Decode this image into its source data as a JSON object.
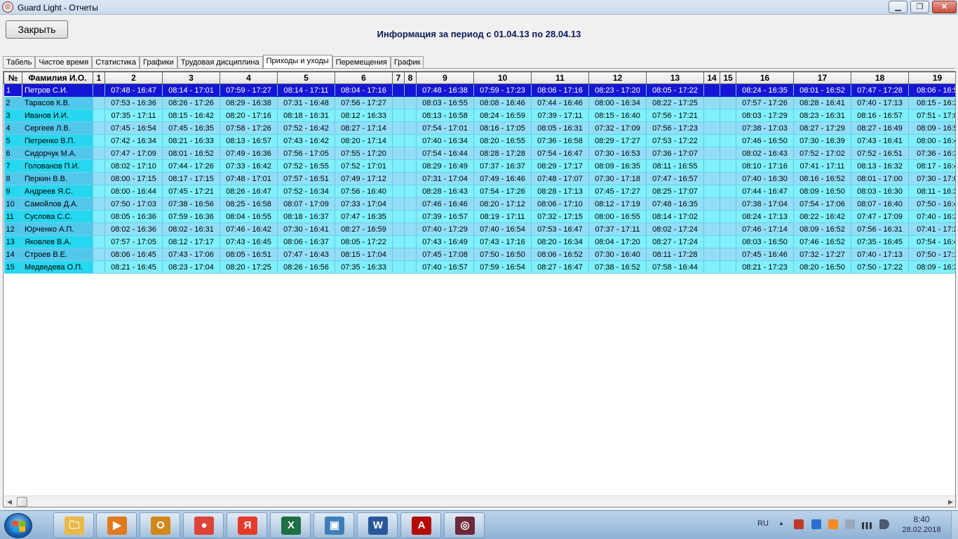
{
  "window": {
    "title": "Guard Light - Отчеты",
    "icon": "app-logo-icon",
    "controls": {
      "minimize": "▁",
      "maximize": "❐",
      "close": "✕"
    }
  },
  "toolbar": {
    "close_label": "Закрыть",
    "period_title": "Информация за период с 01.04.13 по 28.04.13"
  },
  "tabs": [
    {
      "label": "Табель",
      "active": false
    },
    {
      "label": "Чистое время",
      "active": false
    },
    {
      "label": "Статистика",
      "active": false
    },
    {
      "label": "Графики",
      "active": false
    },
    {
      "label": "Трудовая дисциплина",
      "active": false
    },
    {
      "label": "Приходы и уходы",
      "active": true
    },
    {
      "label": "Перемещения",
      "active": false
    },
    {
      "label": "График",
      "active": false
    }
  ],
  "grid": {
    "headers": [
      "№",
      "Фамилия И.О.",
      "1",
      "2",
      "3",
      "4",
      "5",
      "6",
      "7",
      "8",
      "9",
      "10",
      "11",
      "12",
      "13",
      "14",
      "15",
      "16",
      "17",
      "18",
      "19"
    ],
    "selected_row": 0,
    "rows": [
      {
        "num": "1",
        "name": "Петров С.И.",
        "days": [
          "",
          "07:48 - 16:47",
          "08:14 - 17:01",
          "07:59 - 17:27",
          "08:14 - 17:11",
          "08:04 - 17:16",
          "",
          "",
          "07:48 - 16:38",
          "07:59 - 17:23",
          "08:06 - 17:16",
          "08:23 - 17:20",
          "08:05 - 17:22",
          "",
          "",
          "08:24 - 16:35",
          "08:01 - 16:52",
          "07:47 - 17:28",
          "08:06 - 16:5"
        ]
      },
      {
        "num": "2",
        "name": "Тарасов К.В.",
        "days": [
          "",
          "07:53 - 16:36",
          "08:26 - 17:26",
          "08:29 - 16:38",
          "07:31 - 16:48",
          "07:56 - 17:27",
          "",
          "",
          "08:03 - 16:55",
          "08:08 - 16:46",
          "07:44 - 16:46",
          "08:00 - 16:34",
          "08:22 - 17:25",
          "",
          "",
          "07:57 - 17:26",
          "08:28 - 16:41",
          "07:40 - 17:13",
          "08:15 - 16:3"
        ]
      },
      {
        "num": "3",
        "name": "Иванов И.И.",
        "days": [
          "",
          "07:35 - 17:11",
          "08:15 - 16:42",
          "08:20 - 17:16",
          "08:18 - 16:31",
          "08:12 - 16:33",
          "",
          "",
          "08:13 - 16:58",
          "08:24 - 16:59",
          "07:39 - 17:11",
          "08:15 - 16:40",
          "07:56 - 17:21",
          "",
          "",
          "08:03 - 17:29",
          "08:23 - 16:31",
          "08:16 - 16:57",
          "07:51 - 17:0"
        ]
      },
      {
        "num": "4",
        "name": "Сергеев Л.В.",
        "days": [
          "",
          "07:45 - 16:54",
          "07:45 - 16:35",
          "07:58 - 17:26",
          "07:52 - 16:42",
          "08:27 - 17:14",
          "",
          "",
          "07:54 - 17:01",
          "08:16 - 17:05",
          "08:05 - 16:31",
          "07:32 - 17:09",
          "07:56 - 17:23",
          "",
          "",
          "07:38 - 17:03",
          "08:27 - 17:29",
          "08:27 - 16:49",
          "08:09 - 16:5"
        ]
      },
      {
        "num": "5",
        "name": "Петренко В.П.",
        "days": [
          "",
          "07:42 - 16:34",
          "08:21 - 16:33",
          "08:13 - 16:57",
          "07:43 - 16:42",
          "08:20 - 17:14",
          "",
          "",
          "07:40 - 16:34",
          "08:20 - 16:55",
          "07:36 - 16:58",
          "08:29 - 17:27",
          "07:53 - 17:22",
          "",
          "",
          "07:46 - 16:50",
          "07:30 - 16:39",
          "07:43 - 16:41",
          "08:00 - 16:4"
        ]
      },
      {
        "num": "6",
        "name": "Сидорчук М.А.",
        "days": [
          "",
          "07:47 - 17:09",
          "08:01 - 16:52",
          "07:49 - 16:36",
          "07:56 - 17:05",
          "07:55 - 17:20",
          "",
          "",
          "07:54 - 16:44",
          "08:28 - 17:28",
          "07:54 - 16:47",
          "07:30 - 16:53",
          "07:36 - 17:07",
          "",
          "",
          "08:02 - 16:43",
          "07:52 - 17:02",
          "07:52 - 16:51",
          "07:36 - 16:3"
        ]
      },
      {
        "num": "7",
        "name": "Голованов П.И.",
        "days": [
          "",
          "08:02 - 17:10",
          "07:44 - 17:26",
          "07:33 - 16:42",
          "07:52 - 16:55",
          "07:52 - 17:01",
          "",
          "",
          "08:29 - 16:49",
          "07:37 - 16:37",
          "08:29 - 17:17",
          "08:09 - 16:35",
          "08:11 - 16:55",
          "",
          "",
          "08:10 - 17:16",
          "07:41 - 17:11",
          "08:13 - 16:32",
          "08:17 - 16:4"
        ]
      },
      {
        "num": "8",
        "name": "Перкин В.В.",
        "days": [
          "",
          "08:00 - 17:15",
          "08:17 - 17:15",
          "07:48 - 17:01",
          "07:57 - 16:51",
          "07:49 - 17:12",
          "",
          "",
          "07:31 - 17:04",
          "07:49 - 16:46",
          "07:48 - 17:07",
          "07:30 - 17:18",
          "07:47 - 16:57",
          "",
          "",
          "07:40 - 16:30",
          "08:16 - 16:52",
          "08:01 - 17:00",
          "07:30 - 17:0"
        ]
      },
      {
        "num": "9",
        "name": "Андреев Я.С.",
        "days": [
          "",
          "08:00 - 16:44",
          "07:45 - 17:21",
          "08:26 - 16:47",
          "07:52 - 16:34",
          "07:56 - 16:40",
          "",
          "",
          "08:28 - 16:43",
          "07:54 - 17:26",
          "08:28 - 17:13",
          "07:45 - 17:27",
          "08:25 - 17:07",
          "",
          "",
          "07:44 - 16:47",
          "08:09 - 16:50",
          "08:03 - 16:30",
          "08:11 - 16:3"
        ]
      },
      {
        "num": "10",
        "name": "Самойлов Д.А.",
        "days": [
          "",
          "07:50 - 17:03",
          "07:38 - 16:56",
          "08:25 - 16:58",
          "08:07 - 17:09",
          "07:33 - 17:04",
          "",
          "",
          "07:46 - 16:46",
          "08:20 - 17:12",
          "08:06 - 17:10",
          "08:12 - 17:19",
          "07:48 - 16:35",
          "",
          "",
          "07:38 - 17:04",
          "07:54 - 17:06",
          "08:07 - 16:40",
          "07:50 - 16:4"
        ]
      },
      {
        "num": "11",
        "name": "Суслова С.С.",
        "days": [
          "",
          "08:05 - 16:36",
          "07:59 - 16:36",
          "08:04 - 16:55",
          "08:18 - 16:37",
          "07:47 - 16:35",
          "",
          "",
          "07:39 - 16:57",
          "08:19 - 17:11",
          "07:32 - 17:15",
          "08:00 - 16:55",
          "08:14 - 17:02",
          "",
          "",
          "08:24 - 17:13",
          "08:22 - 16:42",
          "07:47 - 17:09",
          "07:40 - 16:3"
        ]
      },
      {
        "num": "12",
        "name": "Юрченко А.П.",
        "days": [
          "",
          "08:02 - 16:36",
          "08:02 - 16:31",
          "07:46 - 16:42",
          "07:30 - 16:41",
          "08:27 - 16:59",
          "",
          "",
          "07:40 - 17:29",
          "07:40 - 16:54",
          "07:53 - 16:47",
          "07:37 - 17:11",
          "08:02 - 17:24",
          "",
          "",
          "07:46 - 17:14",
          "08:09 - 16:52",
          "07:56 - 16:31",
          "07:41 - 17:2"
        ]
      },
      {
        "num": "13",
        "name": "Яковлев В.А.",
        "days": [
          "",
          "07:57 - 17:05",
          "08:12 - 17:17",
          "07:43 - 16:45",
          "08:06 - 16:37",
          "08:05 - 17:22",
          "",
          "",
          "07:43 - 16:49",
          "07:43 - 17:16",
          "08:20 - 16:34",
          "08:04 - 17:20",
          "08:27 - 17:24",
          "",
          "",
          "08:03 - 16:50",
          "07:46 - 16:52",
          "07:35 - 16:45",
          "07:54 - 16:4"
        ]
      },
      {
        "num": "14",
        "name": "Строев В.Е.",
        "days": [
          "",
          "08:06 - 16:45",
          "07:43 - 17:06",
          "08:05 - 16:51",
          "07:47 - 16:43",
          "08:15 - 17:04",
          "",
          "",
          "07:45 - 17:08",
          "07:50 - 16:50",
          "08:06 - 16:52",
          "07:30 - 16:40",
          "08:11 - 17:28",
          "",
          "",
          "07:45 - 16:46",
          "07:32 - 17:27",
          "07:40 - 17:13",
          "07:50 - 17:1"
        ]
      },
      {
        "num": "15",
        "name": "Медведева О.П.",
        "days": [
          "",
          "08:21 - 16:45",
          "08:23 - 17:04",
          "08:20 - 17:25",
          "08:26 - 16:56",
          "07:35 - 16:33",
          "",
          "",
          "07:40 - 16:57",
          "07:59 - 16:54",
          "08:27 - 16:47",
          "07:38 - 16:52",
          "07:58 - 16:44",
          "",
          "",
          "08:21 - 17:23",
          "08:20 - 16:50",
          "07:50 - 17:22",
          "08:09 - 16:3"
        ]
      }
    ]
  },
  "scrollbar": {
    "left_arrow": "◀",
    "right_arrow": "▶"
  },
  "taskbar": {
    "start_icon": "windows-start-icon",
    "apps": [
      {
        "name": "explorer-icon",
        "glyph": "🗀",
        "color": "#e9b949"
      },
      {
        "name": "media-player-icon",
        "glyph": "▶",
        "color": "#e07a1f"
      },
      {
        "name": "outlook-icon",
        "glyph": "O",
        "color": "#d08a1c"
      },
      {
        "name": "chrome-icon",
        "glyph": "●",
        "color": "#db4437"
      },
      {
        "name": "yandex-browser-icon",
        "glyph": "Я",
        "color": "#e53b2c"
      },
      {
        "name": "excel-icon",
        "glyph": "X",
        "color": "#1d7044"
      },
      {
        "name": "photo-viewer-icon",
        "glyph": "▣",
        "color": "#3f7fb8"
      },
      {
        "name": "word-icon",
        "glyph": "W",
        "color": "#2b579a"
      },
      {
        "name": "acrobat-icon",
        "glyph": "A",
        "color": "#b30b00"
      },
      {
        "name": "guard-light-icon",
        "glyph": "◎",
        "color": "#6b2a3a"
      }
    ],
    "language": "RU",
    "tray_arrow": "▲",
    "time": "8:40",
    "date": "28.02.2018"
  }
}
